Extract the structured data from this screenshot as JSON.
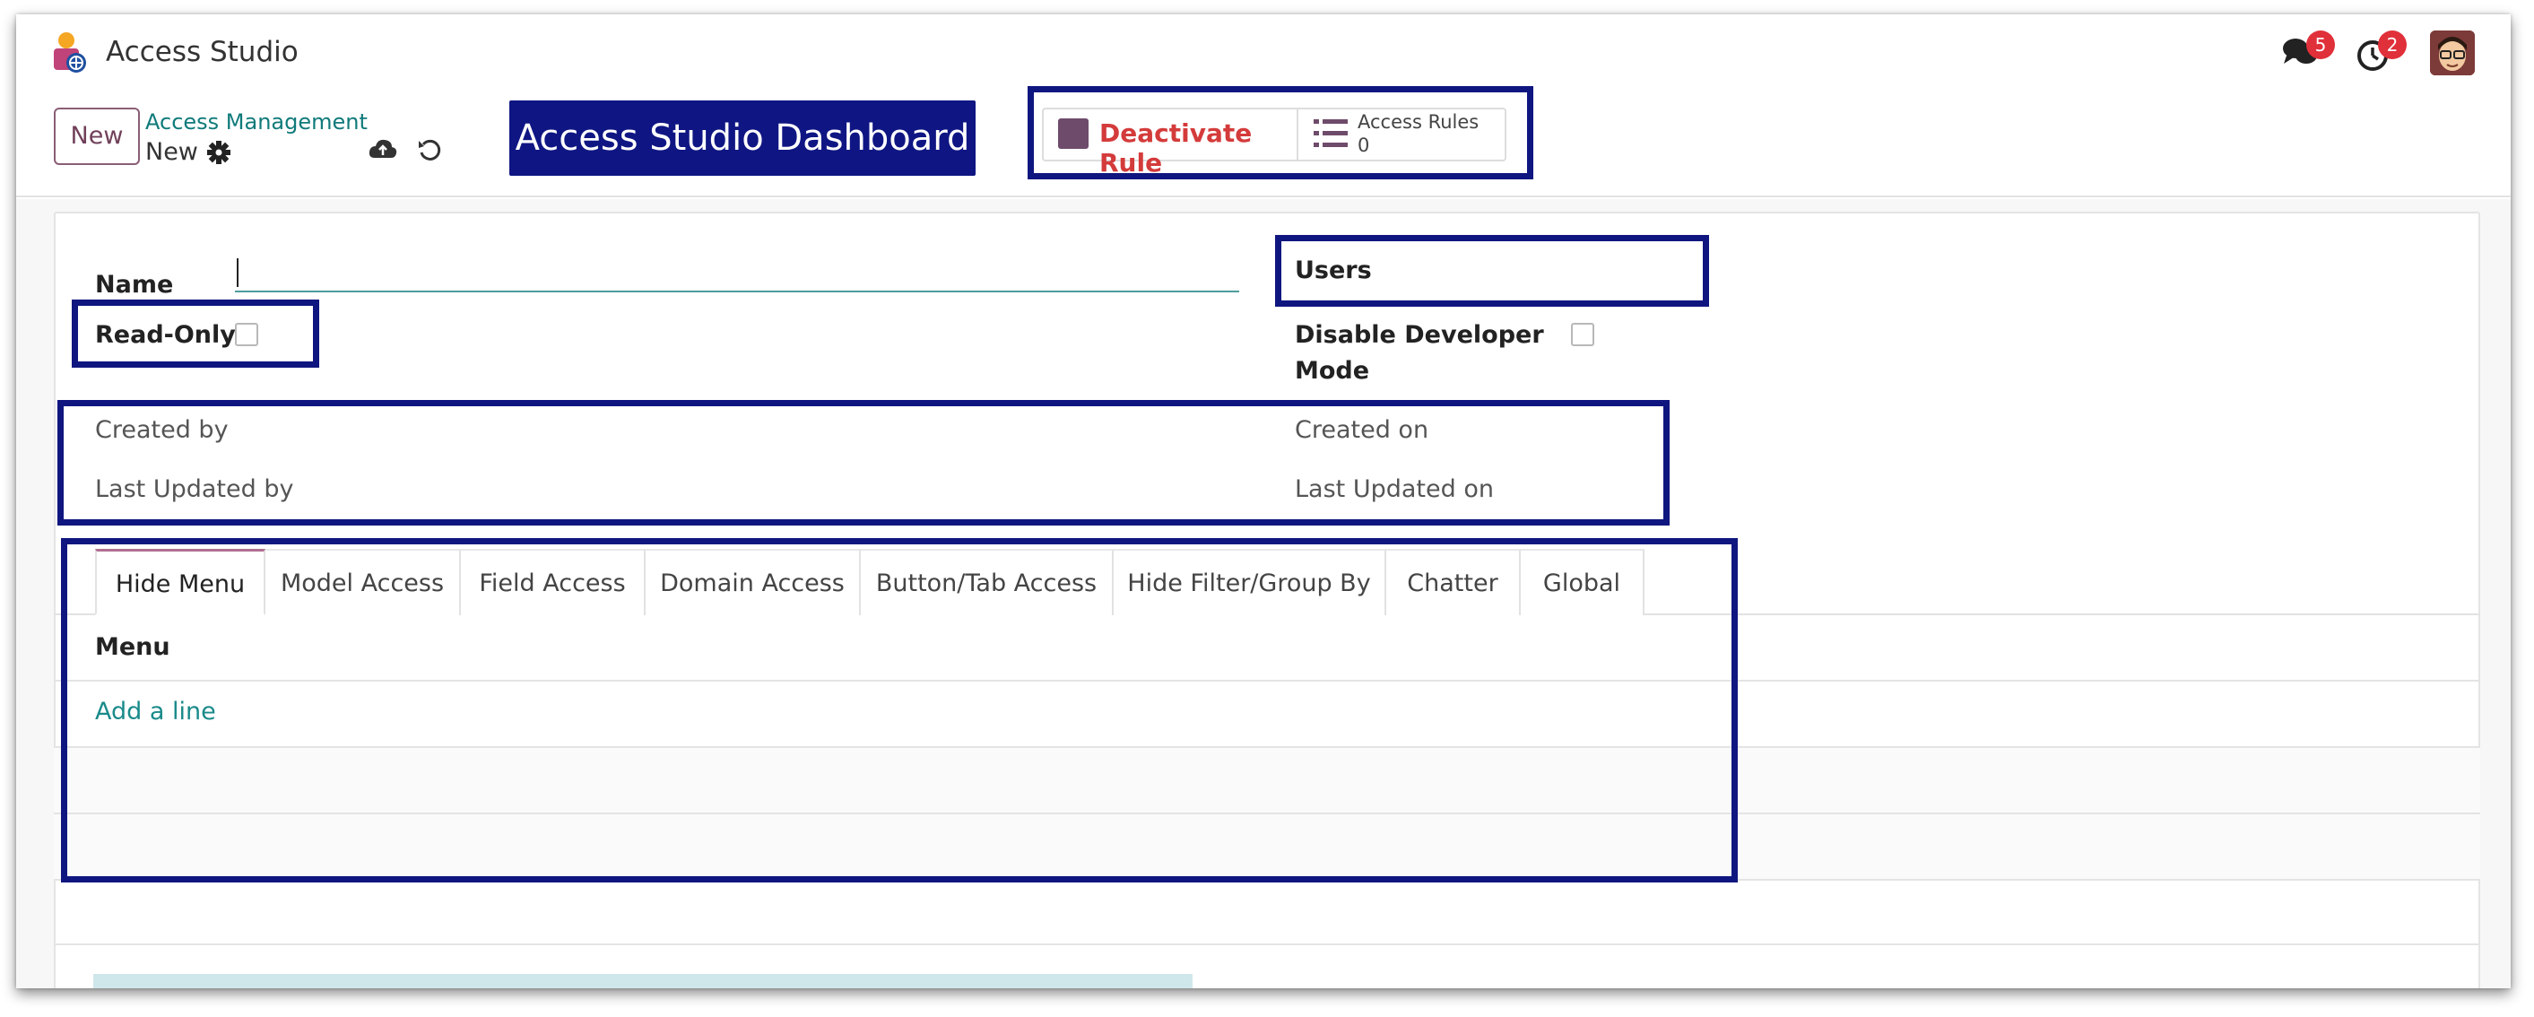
{
  "app": {
    "title": "Access Studio"
  },
  "header": {
    "messages_badge": "5",
    "activities_badge": "2",
    "new_button": "New",
    "breadcrumb_parent": "Access Management",
    "breadcrumb_current": "New",
    "dashboard_button": "Access Studio Dashboard",
    "smart_buttons": {
      "deactivate_label": "Deactivate Rule",
      "access_rules_label": "Access Rules",
      "access_rules_count": "0"
    }
  },
  "form": {
    "name_label": "Name",
    "name_value": "",
    "users_label": "Users",
    "readonly_label": "Read-Only",
    "disable_dev_mode_label_line1": "Disable Developer",
    "disable_dev_mode_label_line2": "Mode",
    "created_by_label": "Created by",
    "created_on_label": "Created on",
    "last_updated_by_label": "Last Updated by",
    "last_updated_on_label": "Last Updated on"
  },
  "tabs": [
    {
      "label": "Hide Menu"
    },
    {
      "label": "Model Access"
    },
    {
      "label": "Field Access"
    },
    {
      "label": "Domain Access"
    },
    {
      "label": "Button/Tab Access"
    },
    {
      "label": "Hide Filter/Group By"
    },
    {
      "label": "Chatter"
    },
    {
      "label": "Global"
    }
  ],
  "table": {
    "column_header": "Menu",
    "add_line_label": "Add a line"
  },
  "colors": {
    "highlight_box": "#10167f",
    "dashboard_bg": "#0f1683",
    "link_teal": "#107a7a",
    "danger_red": "#d43b3b",
    "badge_red": "#e0303a"
  }
}
